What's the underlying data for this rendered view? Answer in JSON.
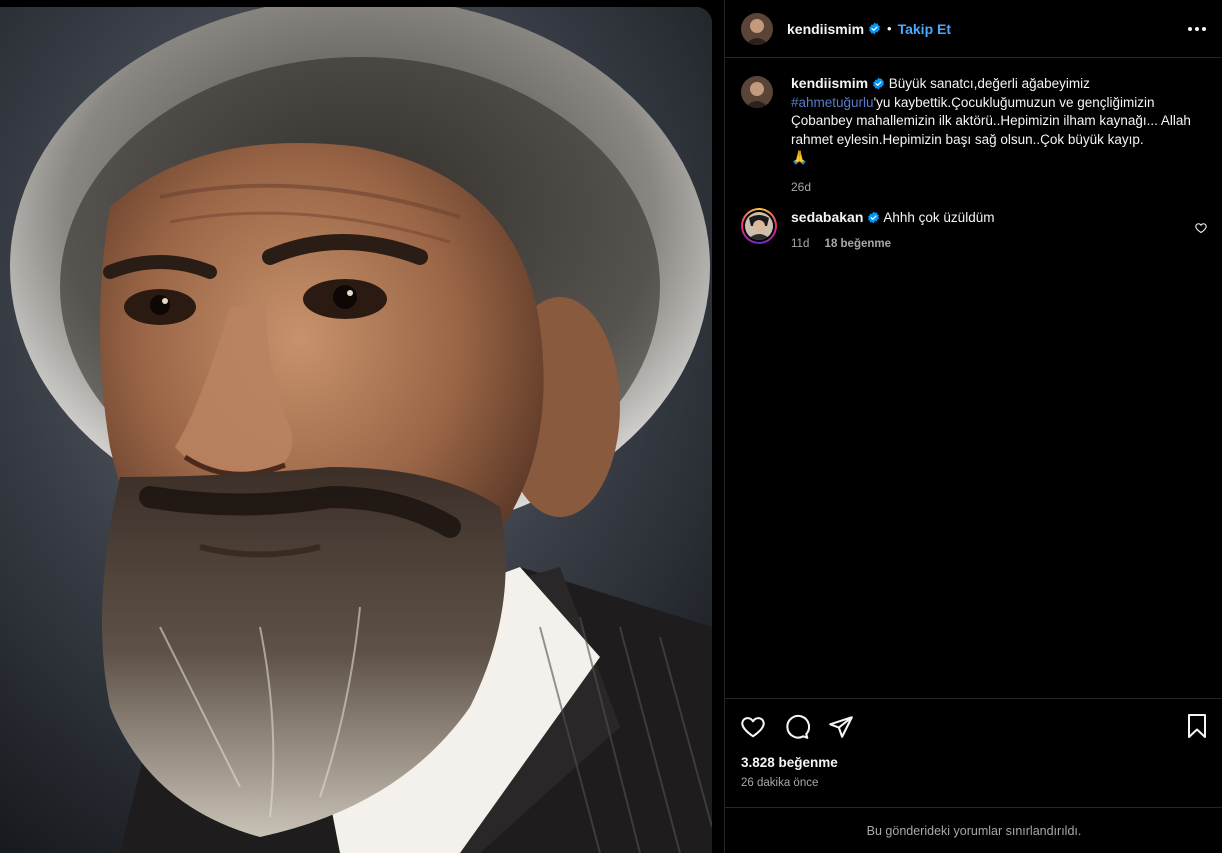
{
  "post": {
    "author": "kendiismim",
    "follow_label": "Takip Et",
    "separator": "•",
    "caption_before": "Büyük sanatcı,değerli ağabeyimiz ",
    "hashtag": "#ahmetuğurlu",
    "caption_after": "'yu kaybettik.Çocukluğumuzun ve gençliğimizin Çobanbey mahallemizin ilk aktörü..Hepimizin ilham kaynağı... Allah rahmet eylesin.Hepimizin başı sağ olsun..Çok büyük kayıp.",
    "caption_emoji": "🙏",
    "caption_time": "26d",
    "likes": "3.828 beğenme",
    "posted_ago": "26 dakika önce",
    "comments_restricted": "Bu gönderideki yorumlar sınırlandırıldı."
  },
  "comments": [
    {
      "user": "sedabakan",
      "text": "Ahhh çok üzüldüm",
      "time": "11d",
      "likes": "18 beğenme"
    }
  ],
  "icons": {
    "verified": "verified-badge-icon",
    "more": "more-options-icon",
    "like": "heart-icon",
    "comment": "comment-icon",
    "share": "share-icon",
    "save": "bookmark-icon"
  },
  "colors": {
    "background": "#000000",
    "link": "#4aa8ff",
    "hashtag": "#5a7bc9",
    "secondary_text": "#a8a8a8",
    "divider": "#262626",
    "verified": "#0095f6"
  }
}
